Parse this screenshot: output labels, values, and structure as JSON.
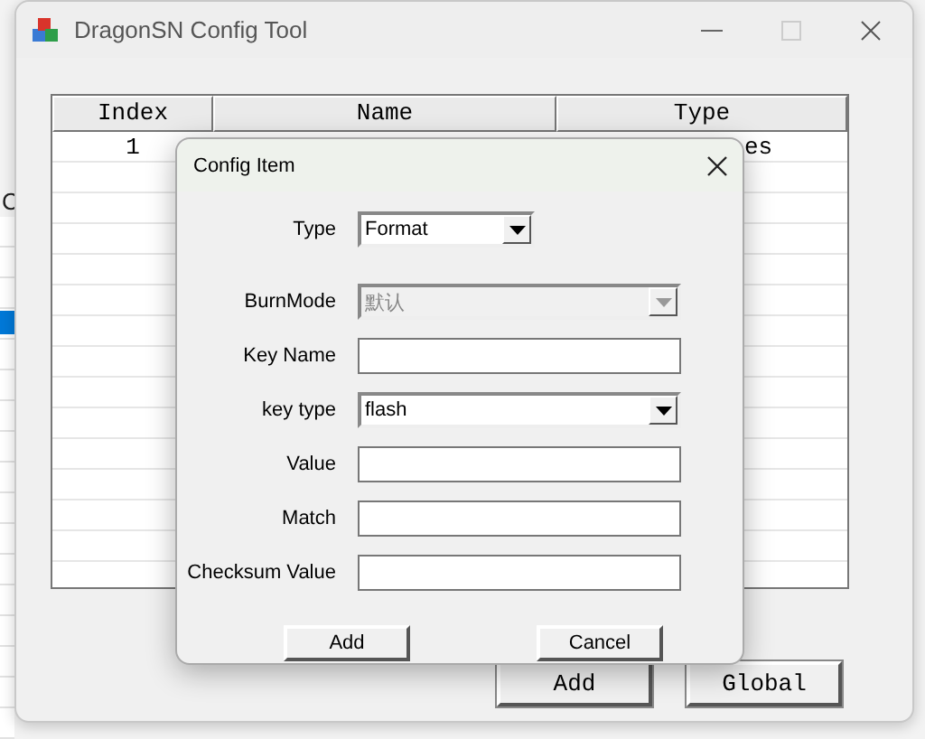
{
  "background": {
    "partial_text": "C"
  },
  "window": {
    "title": "DragonSN Config Tool"
  },
  "table": {
    "columns": [
      "Index",
      "Name",
      "Type"
    ],
    "rows": [
      {
        "index": "1",
        "type": "es"
      }
    ]
  },
  "buttons": [
    "Add",
    "Global"
  ],
  "dialog": {
    "title": "Config Item",
    "fields": [
      {
        "label": "Type",
        "kind": "short-select",
        "value": "Format",
        "disabled": false
      },
      {
        "label": "BurnMode",
        "kind": "select",
        "value": "默认",
        "disabled": true
      },
      {
        "label": "Key Name",
        "kind": "text",
        "disabled": false
      },
      {
        "label": "key type",
        "kind": "select",
        "value": "flash",
        "disabled": false
      },
      {
        "label": "Value",
        "kind": "text",
        "disabled": false
      },
      {
        "label": "Match",
        "kind": "text",
        "disabled": false
      },
      {
        "label": "Checksum Value",
        "kind": "text",
        "disabled": false
      }
    ],
    "buttons": [
      "Add",
      "Cancel"
    ]
  }
}
